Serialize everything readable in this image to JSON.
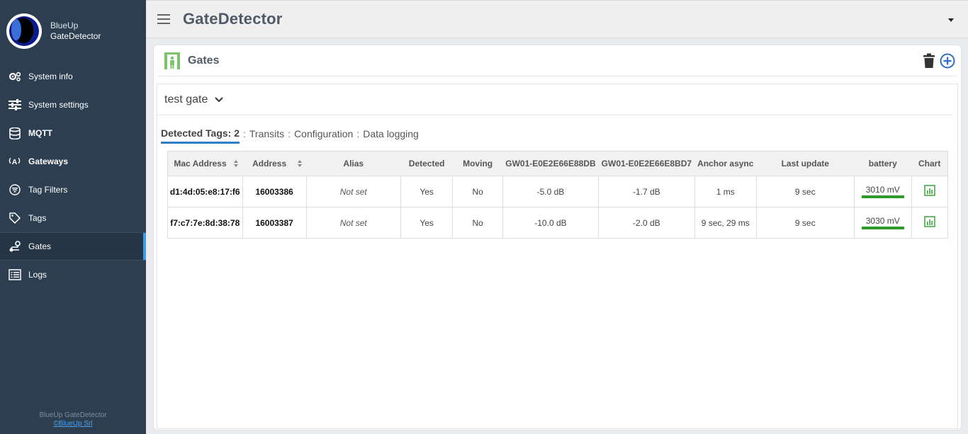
{
  "brand": {
    "line1": "BlueUp",
    "line2": "GateDetector"
  },
  "sidebar": {
    "items": [
      {
        "label": "System info",
        "icon": "gears-icon",
        "bold": false,
        "active": false
      },
      {
        "label": "System settings",
        "icon": "sliders-icon",
        "bold": false,
        "active": false
      },
      {
        "label": "MQTT",
        "icon": "database-icon",
        "bold": true,
        "active": false
      },
      {
        "label": "Gateways",
        "icon": "antenna-icon",
        "bold": true,
        "active": false
      },
      {
        "label": "Tag Filters",
        "icon": "filter-icon",
        "bold": false,
        "active": false
      },
      {
        "label": "Tags",
        "icon": "tag-icon",
        "bold": false,
        "active": false
      },
      {
        "label": "Gates",
        "icon": "route-icon",
        "bold": false,
        "active": true
      },
      {
        "label": "Logs",
        "icon": "list-icon",
        "bold": false,
        "active": false
      }
    ],
    "footer_line1": "BlueUp GateDetector",
    "footer_line2": "©BlueUp Srl"
  },
  "topbar": {
    "title": "GateDetector"
  },
  "card": {
    "title": "Gates"
  },
  "gate_select": {
    "value": "test gate"
  },
  "tabs": [
    {
      "label": "Detected Tags: 2",
      "active": true
    },
    {
      "label": "Transits",
      "active": false
    },
    {
      "label": "Configuration",
      "active": false
    },
    {
      "label": "Data logging",
      "active": false
    }
  ],
  "table": {
    "headers": [
      "Mac Address",
      "Address",
      "Alias",
      "Detected",
      "Moving",
      "GW01-E0E2E66E88DB",
      "GW01-E0E2E66E8BD7",
      "Anchor async",
      "Last update",
      "battery",
      "Chart"
    ],
    "rows": [
      {
        "mac": "d1:4d:05:e8:17:f6",
        "address": "16003386",
        "alias": "Not set",
        "detected": "Yes",
        "moving": "No",
        "gw1": "-5.0 dB",
        "gw2": "-1.7 dB",
        "anchor": "1 ms",
        "last_update": "9 sec",
        "battery": "3010 mV"
      },
      {
        "mac": "f7:c7:7e:8d:38:78",
        "address": "16003387",
        "alias": "Not set",
        "detected": "Yes",
        "moving": "No",
        "gw1": "-10.0 dB",
        "gw2": "-2.0 dB",
        "anchor": "9 sec, 29 ms",
        "last_update": "9 sec",
        "battery": "3030 mV"
      }
    ]
  },
  "colors": {
    "sidebar_bg": "#2c3e50",
    "active_accent": "#3d9be0",
    "battery_ok": "#2e9a2a",
    "chart_icon": "#3aa53a",
    "gate_icon": "#7cc36b"
  }
}
